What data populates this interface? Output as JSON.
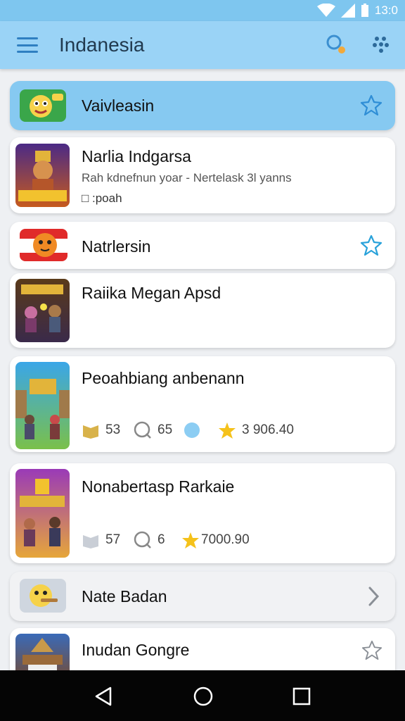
{
  "status": {
    "time": "13:0",
    "wifi_icon": "wifi-icon",
    "signal_icon": "signal-icon",
    "battery_icon": "battery-icon"
  },
  "appbar": {
    "title": "Indanesia",
    "menu_icon": "menu-icon",
    "search_icon": "search-icon",
    "apps_icon": "apps-icon"
  },
  "items": [
    {
      "name": "Vaivleasin",
      "accessory": "star-icon"
    },
    {
      "name": "Narlia Indgarsa",
      "subtitle": "Rah kdnefnun yoar - Nertelask 3l yanns",
      "tag": "□ :poah"
    },
    {
      "name": "Natrlersin",
      "accessory": "star-icon"
    },
    {
      "name": "Raiika Megan Apsd"
    },
    {
      "name": "Peoahbiang anbenann",
      "stats": [
        "53",
        "65",
        "",
        "3 906.40"
      ]
    },
    {
      "name": "Nonabertasp Rarkaie",
      "stats": [
        "57",
        "6",
        "7000.90"
      ]
    },
    {
      "name": "Nate Badan",
      "accessory": "chevron-right-icon"
    },
    {
      "name": "Inudan Gongre",
      "accessory": "star-outline-icon"
    }
  ],
  "navbar": {
    "back_icon": "back-icon",
    "home_icon": "home-icon",
    "recents_icon": "recents-icon"
  },
  "colors": {
    "appbar": "#9ad3f6",
    "status": "#7ec6ef",
    "highlight": "#86c9f1",
    "accent_star": "#3aa6e3",
    "gold_star": "#f5c21b"
  }
}
